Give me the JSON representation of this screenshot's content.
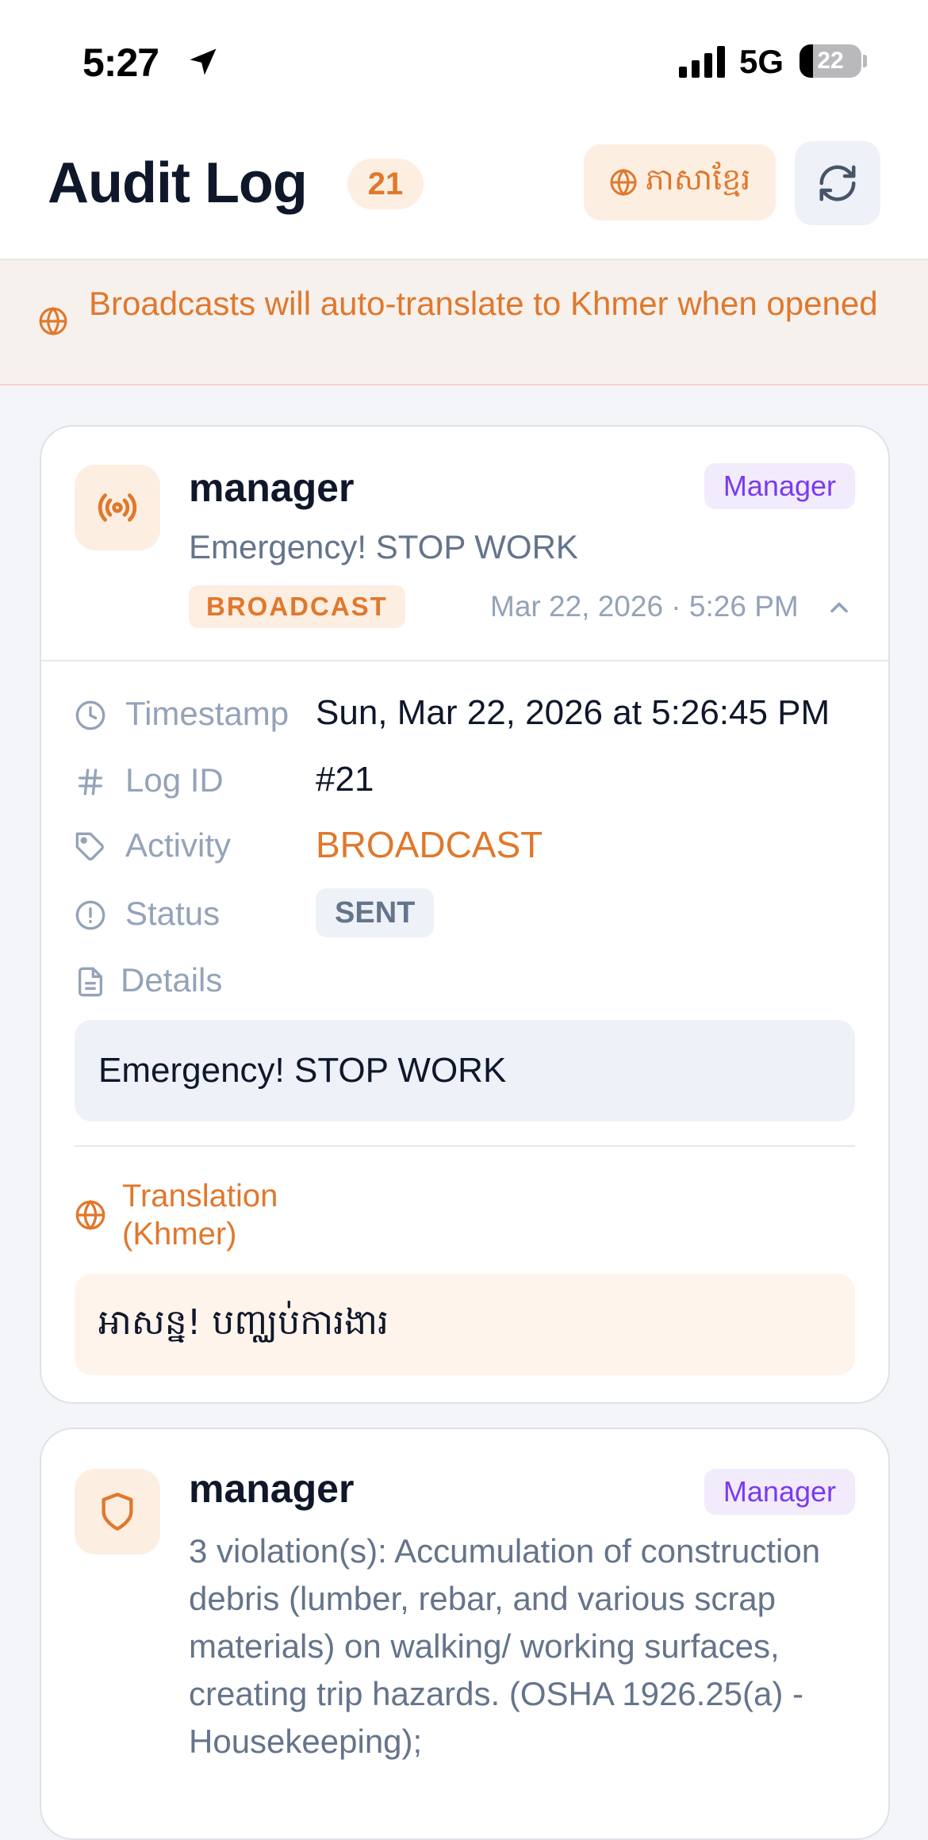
{
  "status_bar": {
    "time": "5:27",
    "network": "5G",
    "battery": "22",
    "battery_fraction": 0.22
  },
  "header": {
    "title": "Audit Log",
    "count": "21",
    "language_button_label": "ភាសាខ្មែរ"
  },
  "banner": {
    "text": "Broadcasts will auto-translate to Khmer when opened"
  },
  "entries": [
    {
      "user": "manager",
      "role": "Manager",
      "message": "Emergency! STOP WORK",
      "type": "BROADCAST",
      "time": "Mar 22, 2026 · 5:26 PM",
      "details": {
        "timestamp_label": "Timestamp",
        "timestamp_value": "Sun, Mar 22, 2026 at 5:26:45 PM",
        "log_id_label": "Log ID",
        "log_id_value": "#21",
        "activity_label": "Activity",
        "activity_value": "BROADCAST",
        "status_label": "Status",
        "status_value": "SENT",
        "details_label": "Details",
        "details_value": "Emergency! STOP WORK",
        "translation_label": "Translation (Khmer)",
        "translation_value": "អាសន្ន! បញ្ឈប់ការងារ"
      }
    },
    {
      "user": "manager",
      "role": "Manager",
      "message": "3 violation(s): Accumulation of construction debris (lumber, rebar, and various scrap materials) on walking/ working surfaces, creating trip hazards. (OSHA 1926.25(a) - Housekeeping);"
    }
  ],
  "colors": {
    "accent": "#e0782c",
    "accent_bg": "#fdeee2",
    "role": "#7c3aed",
    "muted": "#94a3b8"
  },
  "icons": {
    "location": "location-arrow-icon",
    "signal": "signal-bars-icon",
    "globe": "globe-icon",
    "refresh": "refresh-icon",
    "broadcast": "broadcast-icon",
    "shield": "shield-icon",
    "clock": "clock-icon",
    "hash": "hash-icon",
    "tag": "tag-icon",
    "alert": "alert-circle-icon",
    "document": "document-icon",
    "chevron": "chevron-up-icon"
  }
}
